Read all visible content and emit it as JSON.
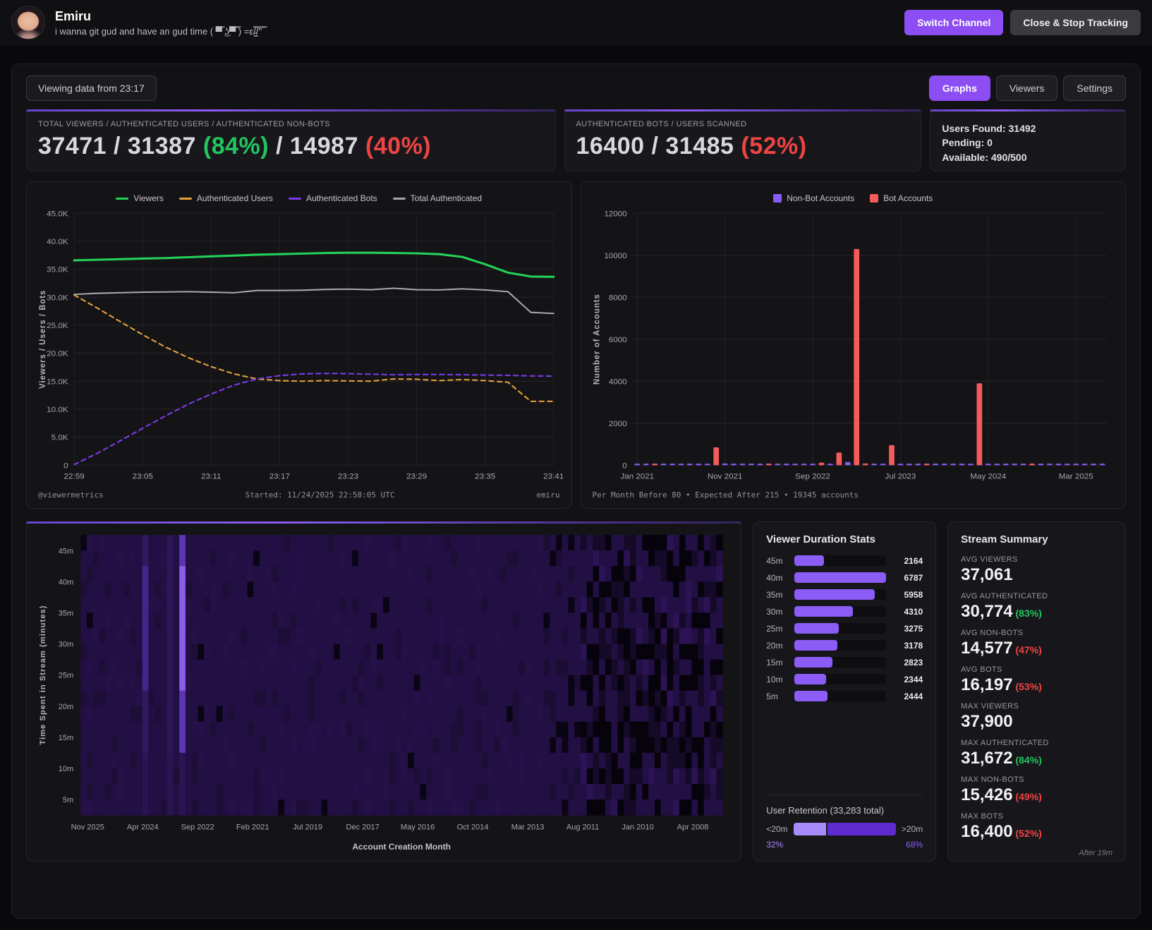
{
  "header": {
    "channel_name": "Emiru",
    "channel_status": "i wanna git gud and have an gud time ( ▀̿ ͜ʖ▀̿ ̿) =ε/̵͇̿̿/'̿'̿ ̿",
    "switch_channel_label": "Switch Channel",
    "close_stop_label": "Close & Stop Tracking"
  },
  "toolbar": {
    "viewing_label": "Viewing data from 23:17",
    "tabs": [
      {
        "label": "Graphs",
        "active": true
      },
      {
        "label": "Viewers",
        "active": false
      },
      {
        "label": "Settings",
        "active": false
      }
    ]
  },
  "stats": {
    "left": {
      "label": "TOTAL VIEWERS / AUTHENTICATED USERS / AUTHENTICATED NON-BOTS",
      "seg1": "37471 / 31387 ",
      "pct1": "(84%)",
      "seg2": " / 14987 ",
      "pct2": "(40%)"
    },
    "mid": {
      "label": "AUTHENTICATED BOTS / USERS SCANNED",
      "seg1": "16400 / 31485 ",
      "pct1": "(52%)"
    },
    "right": {
      "users_found": "Users Found: 31492",
      "pending": "Pending: 0",
      "available": "Available: 490/500"
    }
  },
  "chart_data": [
    {
      "id": "viewer_lines",
      "type": "line",
      "ylabel": "Viewers / Users / Bots",
      "ylim": [
        0,
        45000
      ],
      "y_ticks": [
        "0",
        "5.0K",
        "10.0K",
        "15.0K",
        "20.0K",
        "25.0K",
        "30.0K",
        "35.0K",
        "40.0K",
        "45.0K"
      ],
      "x_ticks": [
        "22:59",
        "23:05",
        "23:11",
        "23:17",
        "23:23",
        "23:29",
        "23:35",
        "23:41"
      ],
      "x_tick_idx": [
        0,
        3,
        6,
        9,
        12,
        15,
        18,
        21
      ],
      "grid": true,
      "legend_position": "top",
      "series": [
        {
          "name": "Viewers",
          "color": "#24d05a",
          "dash": false,
          "width": 3,
          "values": [
            36600,
            36700,
            36800,
            36900,
            37000,
            37150,
            37300,
            37450,
            37600,
            37700,
            37800,
            37900,
            37950,
            37950,
            37900,
            37850,
            37700,
            37200,
            35900,
            34400,
            33700,
            33650
          ]
        },
        {
          "name": "Authenticated Users",
          "color": "#e6a23c",
          "dash": true,
          "width": 2,
          "values": [
            30400,
            28100,
            25700,
            23300,
            21100,
            19200,
            17600,
            16300,
            15400,
            15100,
            15000,
            15100,
            15050,
            15000,
            15400,
            15350,
            15100,
            15300,
            15100,
            14800,
            11400,
            11400
          ]
        },
        {
          "name": "Authenticated Bots",
          "color": "#7c3aed",
          "dash": true,
          "width": 2,
          "values": [
            100,
            2100,
            4300,
            6600,
            8800,
            10900,
            12700,
            14300,
            15400,
            16000,
            16300,
            16400,
            16350,
            16250,
            16150,
            16200,
            16200,
            16150,
            16100,
            16050,
            15950,
            15900
          ]
        },
        {
          "name": "Total Authenticated",
          "color": "#a7a7ad",
          "dash": false,
          "width": 2,
          "values": [
            30500,
            30700,
            30800,
            30900,
            30950,
            31000,
            30900,
            30800,
            31200,
            31200,
            31250,
            31400,
            31450,
            31350,
            31600,
            31350,
            31300,
            31500,
            31300,
            31000,
            27300,
            27100
          ]
        }
      ],
      "footer_left": "@viewermetrics",
      "footer_center": "Started: 11/24/2025 22:58:05 UTC",
      "footer_right": "emiru"
    },
    {
      "id": "account_creation_bars",
      "type": "bar",
      "ylabel": "Number of Accounts",
      "ylim": [
        0,
        12000
      ],
      "y_ticks": [
        "0",
        "2000",
        "4000",
        "6000",
        "8000",
        "10000",
        "12000"
      ],
      "x_ticks": [
        "Jan 2021",
        "Nov 2021",
        "Sep 2022",
        "Jul 2023",
        "May 2024",
        "Mar 2025"
      ],
      "x_tick_idx": [
        0,
        10,
        20,
        30,
        40,
        50
      ],
      "grid": true,
      "legend_position": "top",
      "categories_note": "monthly Jan 2021 - Jun 2025",
      "series": [
        {
          "name": "Non-Bot Accounts",
          "color": "#8b5cf6",
          "values": [
            70,
            55,
            60,
            50,
            65,
            45,
            60,
            55,
            50,
            60,
            80,
            55,
            50,
            45,
            60,
            50,
            55,
            45,
            50,
            55,
            65,
            50,
            45,
            60,
            150,
            90,
            70,
            55,
            60,
            50,
            45,
            55,
            50,
            45,
            40,
            50,
            45,
            40,
            45,
            60,
            50,
            45,
            40,
            45,
            40,
            35,
            40,
            35,
            40,
            35,
            40,
            35,
            30,
            35
          ]
        },
        {
          "name": "Bot Accounts",
          "color": "#f45b5b",
          "values": [
            0,
            0,
            30,
            0,
            0,
            0,
            0,
            0,
            0,
            850,
            0,
            0,
            0,
            0,
            0,
            25,
            0,
            0,
            0,
            0,
            0,
            120,
            0,
            600,
            0,
            10300,
            80,
            0,
            0,
            950,
            0,
            0,
            0,
            40,
            0,
            0,
            0,
            0,
            0,
            3900,
            0,
            0,
            0,
            0,
            0,
            25,
            0,
            0,
            0,
            0,
            0,
            0,
            0,
            0
          ]
        }
      ],
      "footer": "Per Month Before 80 • Expected After 215 • 19345 accounts"
    },
    {
      "id": "duration_heatmap",
      "type": "heatmap",
      "ylabel": "Time Spent in Stream (minutes)",
      "xlabel": "Account Creation Month",
      "y_ticks": [
        "45m",
        "40m",
        "35m",
        "30m",
        "25m",
        "20m",
        "15m",
        "10m",
        "5m"
      ],
      "x_ticks": [
        "Nov 2025",
        "Apr 2024",
        "Sep 2022",
        "Feb 2021",
        "Jul 2019",
        "Dec 2017",
        "May 2016",
        "Oct 2014",
        "Mar 2013",
        "Aug 2011",
        "Jan 2010",
        "Apr 2008"
      ],
      "base_color": "#221044",
      "bright_color": "#8a5ce8",
      "dark_color": "#07030d",
      "cols": 104,
      "rows": 18,
      "patchy_start_frac": 0.77,
      "bright_cols": [
        {
          "frac": 0.099,
          "strength": 0.5
        },
        {
          "frac": 0.135,
          "strength": 0.25
        },
        {
          "frac": 0.158,
          "strength": 1.0
        }
      ]
    }
  ],
  "duration_stats": {
    "title": "Viewer Duration Stats",
    "max_value": 6787,
    "rows": [
      {
        "label": "45m",
        "value": "2164",
        "frac": 0.319
      },
      {
        "label": "40m",
        "value": "6787",
        "frac": 1.0
      },
      {
        "label": "35m",
        "value": "5958",
        "frac": 0.878
      },
      {
        "label": "30m",
        "value": "4310",
        "frac": 0.635
      },
      {
        "label": "25m",
        "value": "3275",
        "frac": 0.483
      },
      {
        "label": "20m",
        "value": "3178",
        "frac": 0.468
      },
      {
        "label": "15m",
        "value": "2823",
        "frac": 0.416
      },
      {
        "label": "10m",
        "value": "2344",
        "frac": 0.345
      },
      {
        "label": "5m",
        "value": "2444",
        "frac": 0.36
      }
    ],
    "retention": {
      "title": "User Retention (33,283 total)",
      "left_label": "<20m",
      "right_label": ">20m",
      "left_pct": "32%",
      "right_pct": "68%",
      "left_frac": 0.32
    }
  },
  "stream_summary": {
    "title": "Stream Summary",
    "groups": [
      {
        "rows": [
          {
            "label": "AVG VIEWERS",
            "value": "37,061",
            "pct": "",
            "pct_color": ""
          },
          {
            "label": "AVG AUTHENTICATED",
            "value": "30,774",
            "pct": "(83%)",
            "pct_color": "green"
          },
          {
            "label": "AVG NON-BOTS",
            "value": "14,577",
            "pct": "(47%)",
            "pct_color": "red"
          },
          {
            "label": "AVG BOTS",
            "value": "16,197",
            "pct": "(53%)",
            "pct_color": "red"
          }
        ]
      },
      {
        "rows": [
          {
            "label": "MAX VIEWERS",
            "value": "37,900",
            "pct": "",
            "pct_color": ""
          },
          {
            "label": "MAX AUTHENTICATED",
            "value": "31,672",
            "pct": "(84%)",
            "pct_color": "green"
          },
          {
            "label": "MAX NON-BOTS",
            "value": "15,426",
            "pct": "(49%)",
            "pct_color": "red"
          },
          {
            "label": "MAX BOTS",
            "value": "16,400",
            "pct": "(52%)",
            "pct_color": "red"
          }
        ]
      }
    ],
    "footnote": "After 19m"
  }
}
